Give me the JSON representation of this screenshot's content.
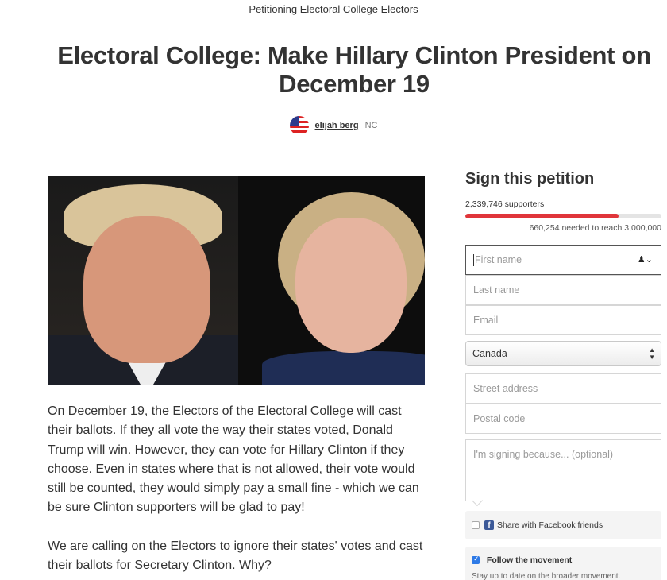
{
  "header": {
    "petitioning_prefix": "Petitioning",
    "target": "Electoral College Electors"
  },
  "petition": {
    "title": "Electoral College: Make Hillary Clinton President on December 19",
    "author_name": "elijah berg",
    "author_location": "NC"
  },
  "body": {
    "paragraphs": [
      "On December 19, the Electors of the Electoral College will cast their ballots. If they all vote the way their states voted, Donald Trump will win. However, they can vote for Hillary Clinton if they choose. Even in states where that is not allowed, their vote would still be counted, they would simply pay a small fine - which we can be sure Clinton supporters will be glad to pay!",
      "We are calling on the Electors to ignore their states' votes and cast their ballots for Secretary Clinton. Why?"
    ]
  },
  "sign": {
    "title": "Sign this petition",
    "supporters_text": "2,339,746 supporters",
    "progress_fraction": 0.78,
    "needed_text": "660,254 needed to reach 3,000,000",
    "progress_color": "#e0353a"
  },
  "form": {
    "first_name_placeholder": "First name",
    "last_name_placeholder": "Last name",
    "email_placeholder": "Email",
    "country_selected": "Canada",
    "street_placeholder": "Street address",
    "postal_placeholder": "Postal code",
    "reason_placeholder": "I'm signing because... (optional)",
    "facebook_label": "Share with Facebook friends",
    "facebook_checked": false,
    "follow_title": "Follow the movement",
    "follow_checked": true,
    "follow_sub": "Stay up to date on the broader movement."
  },
  "icons": {
    "author_avatar": "us-flag-avatar",
    "first_name_field": "person-icon",
    "facebook": "facebook-icon",
    "country_select": "select-arrows-icon"
  }
}
